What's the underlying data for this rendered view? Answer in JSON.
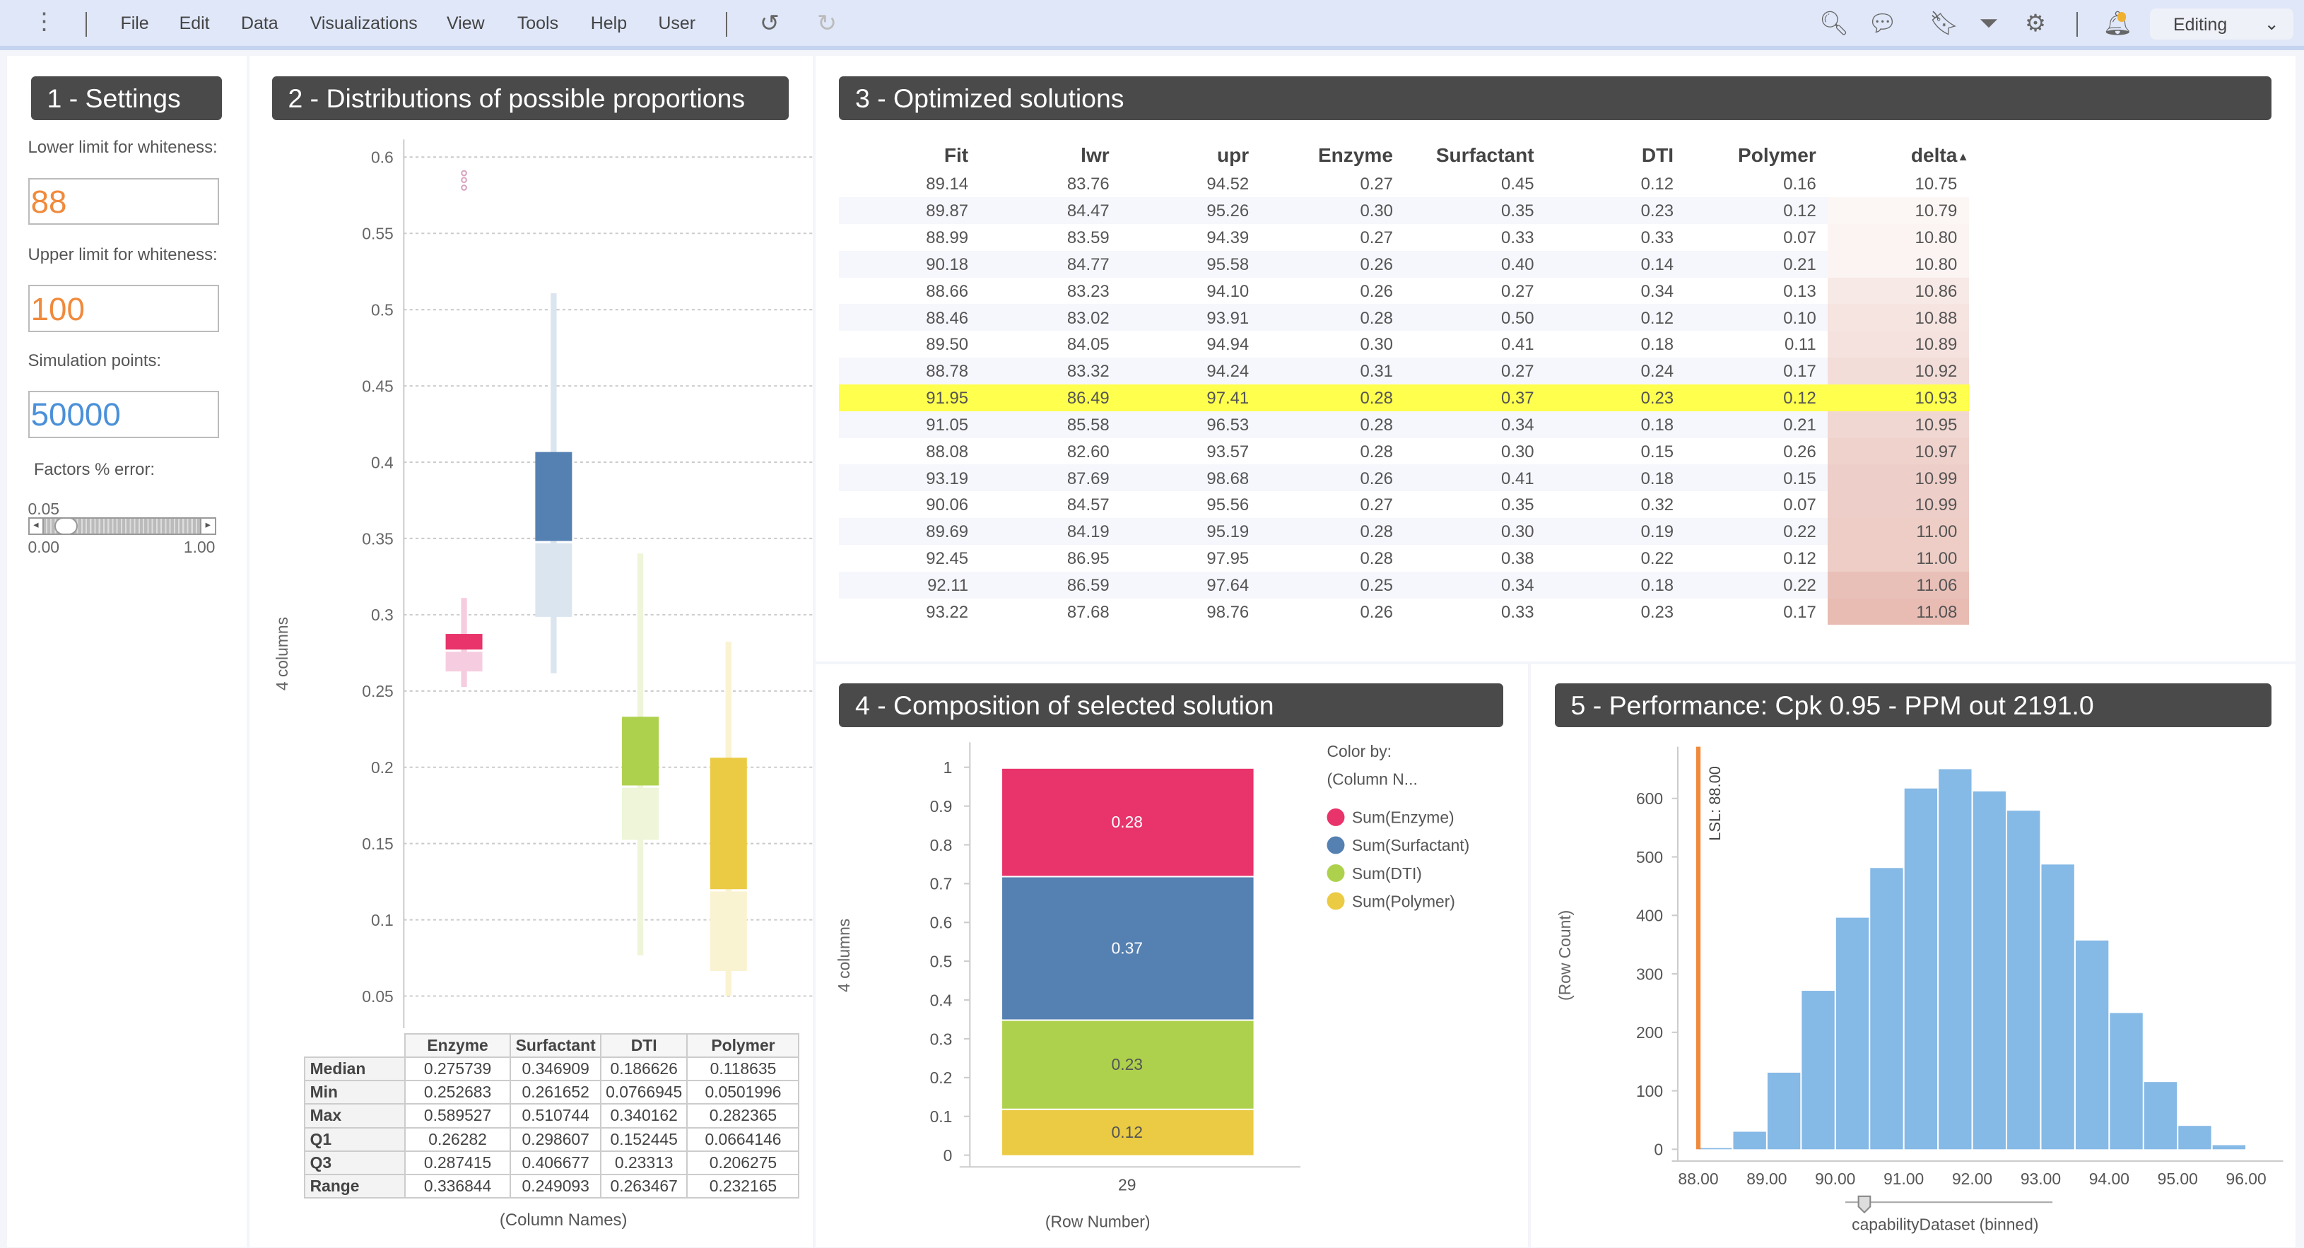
{
  "toolbar": {
    "menu": [
      "File",
      "Edit",
      "Data",
      "Visualizations",
      "View",
      "Tools",
      "Help",
      "User"
    ],
    "icons": [
      "more-vertical-icon",
      "undo-icon",
      "redo-icon",
      "search-icon",
      "comments-icon",
      "bookmark-icon",
      "filter-icon",
      "gear-icon",
      "notification-bell-icon"
    ],
    "mode": "Editing"
  },
  "panel1": {
    "title": "1 - Settings",
    "lower_label": "Lower limit for whiteness:",
    "lower_value": "88",
    "upper_label": "Upper limit for whiteness:",
    "upper_value": "100",
    "sim_label": "Simulation points:",
    "sim_value": "50000",
    "error_label": "Factors % error:",
    "slider_value": "0.05",
    "slider_min": "0.00",
    "slider_max": "1.00",
    "input_color_orange": "#f08a3c",
    "input_color_blue": "#4a90d9"
  },
  "panel2": {
    "title": "2 - Distributions of possible proportions",
    "ylabel": "4 columns",
    "xlabel": "(Column Names)",
    "stats_header": [
      "Enzyme",
      "Surfactant",
      "DTI",
      "Polymer"
    ],
    "stats_rows": [
      {
        "label": "Median",
        "values": [
          "0.275739",
          "0.346909",
          "0.186626",
          "0.118635"
        ]
      },
      {
        "label": "Min",
        "values": [
          "0.252683",
          "0.261652",
          "0.0766945",
          "0.0501996"
        ]
      },
      {
        "label": "Max",
        "values": [
          "0.589527",
          "0.510744",
          "0.340162",
          "0.282365"
        ]
      },
      {
        "label": "Q1",
        "values": [
          "0.26282",
          "0.298607",
          "0.152445",
          "0.0664146"
        ]
      },
      {
        "label": "Q3",
        "values": [
          "0.287415",
          "0.406677",
          "0.23313",
          "0.206275"
        ]
      },
      {
        "label": "Range",
        "values": [
          "0.336844",
          "0.249093",
          "0.263467",
          "0.232165"
        ]
      }
    ]
  },
  "panel3": {
    "title": "3 - Optimized solutions",
    "columns": [
      "Fit",
      "lwr",
      "upr",
      "Enzyme",
      "Surfactant",
      "DTI",
      "Polymer",
      "delta"
    ],
    "sort_indicator": "▲",
    "selected_row": 8,
    "highlight_color": "#ffff4d",
    "rows": [
      [
        "89.14",
        "83.76",
        "94.52",
        "0.27",
        "0.45",
        "0.12",
        "0.16",
        "10.75"
      ],
      [
        "89.87",
        "84.47",
        "95.26",
        "0.30",
        "0.35",
        "0.23",
        "0.12",
        "10.79"
      ],
      [
        "88.99",
        "83.59",
        "94.39",
        "0.27",
        "0.33",
        "0.33",
        "0.07",
        "10.80"
      ],
      [
        "90.18",
        "84.77",
        "95.58",
        "0.26",
        "0.40",
        "0.14",
        "0.21",
        "10.80"
      ],
      [
        "88.66",
        "83.23",
        "94.10",
        "0.26",
        "0.27",
        "0.34",
        "0.13",
        "10.86"
      ],
      [
        "88.46",
        "83.02",
        "93.91",
        "0.28",
        "0.50",
        "0.12",
        "0.10",
        "10.88"
      ],
      [
        "89.50",
        "84.05",
        "94.94",
        "0.30",
        "0.41",
        "0.18",
        "0.11",
        "10.89"
      ],
      [
        "88.78",
        "83.32",
        "94.24",
        "0.31",
        "0.27",
        "0.24",
        "0.17",
        "10.92"
      ],
      [
        "91.95",
        "86.49",
        "97.41",
        "0.28",
        "0.37",
        "0.23",
        "0.12",
        "10.93"
      ],
      [
        "91.05",
        "85.58",
        "96.53",
        "0.28",
        "0.34",
        "0.18",
        "0.21",
        "10.95"
      ],
      [
        "88.08",
        "82.60",
        "93.57",
        "0.28",
        "0.30",
        "0.15",
        "0.26",
        "10.97"
      ],
      [
        "93.19",
        "87.69",
        "98.68",
        "0.26",
        "0.41",
        "0.18",
        "0.15",
        "10.99"
      ],
      [
        "90.06",
        "84.57",
        "95.56",
        "0.27",
        "0.35",
        "0.32",
        "0.07",
        "10.99"
      ],
      [
        "89.69",
        "84.19",
        "95.19",
        "0.28",
        "0.30",
        "0.19",
        "0.22",
        "11.00"
      ],
      [
        "92.45",
        "86.95",
        "97.95",
        "0.28",
        "0.38",
        "0.22",
        "0.12",
        "11.00"
      ],
      [
        "92.11",
        "86.59",
        "97.64",
        "0.25",
        "0.34",
        "0.18",
        "0.22",
        "11.06"
      ],
      [
        "93.22",
        "87.68",
        "98.76",
        "0.26",
        "0.33",
        "0.23",
        "0.17",
        "11.08"
      ]
    ]
  },
  "panel4": {
    "title": "4 - Composition of selected solution"
  },
  "panel5": {
    "title": "5 - Performance: Cpk 0.95 - PPM out 2191.0"
  },
  "chart_data": [
    {
      "type": "box",
      "ylabel": "4 columns",
      "xlabel": "(Column Names)",
      "ylim": [
        0.05,
        0.6
      ],
      "yticks": [
        0.05,
        0.1,
        0.15,
        0.2,
        0.25,
        0.3,
        0.35,
        0.4,
        0.45,
        0.5,
        0.55,
        0.6
      ],
      "grid": true,
      "categories": [
        "Enzyme",
        "Surfactant",
        "DTI",
        "Polymer"
      ],
      "colors": [
        "#e8336b",
        "#5580b2",
        "#aed14d",
        "#ebcb43"
      ],
      "light_colors": [
        "#f6cde0",
        "#dbe5f0",
        "#eef5d9",
        "#faf3d2"
      ],
      "median": [
        0.275739,
        0.346909,
        0.186626,
        0.118635
      ],
      "q1": [
        0.26282,
        0.298607,
        0.152445,
        0.0664146
      ],
      "q3": [
        0.287415,
        0.406677,
        0.23313,
        0.206275
      ],
      "whisker_low": [
        0.252683,
        0.261652,
        0.0766945,
        0.0501996
      ],
      "whisker_high": [
        0.311,
        0.510744,
        0.340162,
        0.282365
      ],
      "outliers": [
        [
          0.58,
          0.585,
          0.5895
        ],
        [],
        [],
        []
      ]
    },
    {
      "type": "bar",
      "stacked": true,
      "ylabel": "4 columns",
      "xlabel": "(Row Number)",
      "categories": [
        "29"
      ],
      "ylim": [
        0,
        1
      ],
      "yticks": [
        "0",
        "0.1",
        "0.2",
        "0.3",
        "0.4",
        "0.5",
        "0.6",
        "0.7",
        "0.8",
        "0.9",
        "1"
      ],
      "legend_title": "Color by:",
      "legend_subtitle": "(Column N...",
      "legend_position": "right",
      "series": [
        {
          "name": "Sum(Polymer)",
          "values": [
            0.12
          ],
          "color": "#ebcb43",
          "label": "0.12"
        },
        {
          "name": "Sum(DTI)",
          "values": [
            0.23
          ],
          "color": "#aed14d",
          "label": "0.23"
        },
        {
          "name": "Sum(Surfactant)",
          "values": [
            0.37
          ],
          "color": "#5580b2",
          "label": "0.37"
        },
        {
          "name": "Sum(Enzyme)",
          "values": [
            0.28
          ],
          "color": "#e8336b",
          "label": "0.28"
        }
      ],
      "legend_order": [
        "Sum(Enzyme)",
        "Sum(Surfactant)",
        "Sum(DTI)",
        "Sum(Polymer)"
      ]
    },
    {
      "type": "bar",
      "subtype": "histogram",
      "ylabel": "(Row Count)",
      "xlabel": "capabilityDataset (binned)",
      "xlim": [
        88,
        96
      ],
      "ylim": [
        0,
        680
      ],
      "xticks": [
        "88.00",
        "89.00",
        "90.00",
        "91.00",
        "92.00",
        "93.00",
        "94.00",
        "95.00",
        "96.00"
      ],
      "yticks": [
        "0",
        "100",
        "200",
        "300",
        "400",
        "500",
        "600"
      ],
      "bin_width": 0.5,
      "bin_starts": [
        88.0,
        88.5,
        89.0,
        89.5,
        90.0,
        90.5,
        91.0,
        91.5,
        92.0,
        92.5,
        93.0,
        93.5,
        94.0,
        94.5,
        95.0,
        95.5
      ],
      "values": [
        2,
        30,
        131,
        271,
        396,
        481,
        617,
        650,
        612,
        579,
        487,
        357,
        233,
        115,
        40,
        7
      ],
      "color": "#85b9e6",
      "reference_line": {
        "label": "LSL: 88.00",
        "value": 88,
        "color": "#f08a3c"
      }
    }
  ]
}
